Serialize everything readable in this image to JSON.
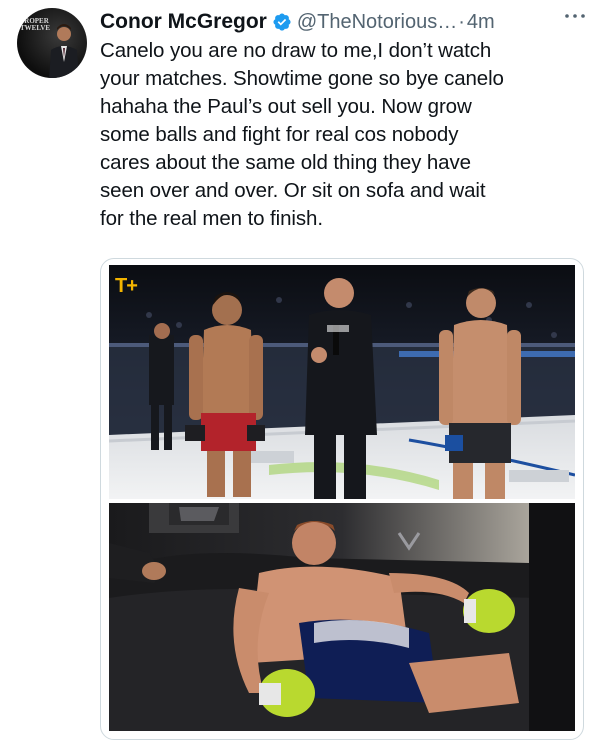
{
  "tweet": {
    "author_name": "Conor McGregor",
    "handle": "@TheNotorious…",
    "separator": "·",
    "time": "4m",
    "avatar_text": "PROPER\nTWELVE",
    "text": "Canelo you are no draw to me,I don’t watch\nyour matches. Showtime gone so bye canelo\nhahaha the Paul’s out sell you. Now grow\nsome balls and fight for real cos nobody\ncares about the same old thing they have\nseen over and over. Or sit on sofa and wait\nfor the real men to finish."
  },
  "media": {
    "photo1": {
      "logo_text": "T",
      "logo_plus": "+",
      "description": "two fighters facing off with referee in octagon"
    },
    "photo2": {
      "description": "boxer slumped on couch after fight"
    }
  },
  "icons": {
    "verified": "verified-badge-icon",
    "more": "more-options-icon"
  },
  "colors": {
    "verified_blue": "#1d9bf0",
    "secondary_text": "#536471",
    "primary_text": "#0f1419",
    "border": "#cfd9de"
  }
}
